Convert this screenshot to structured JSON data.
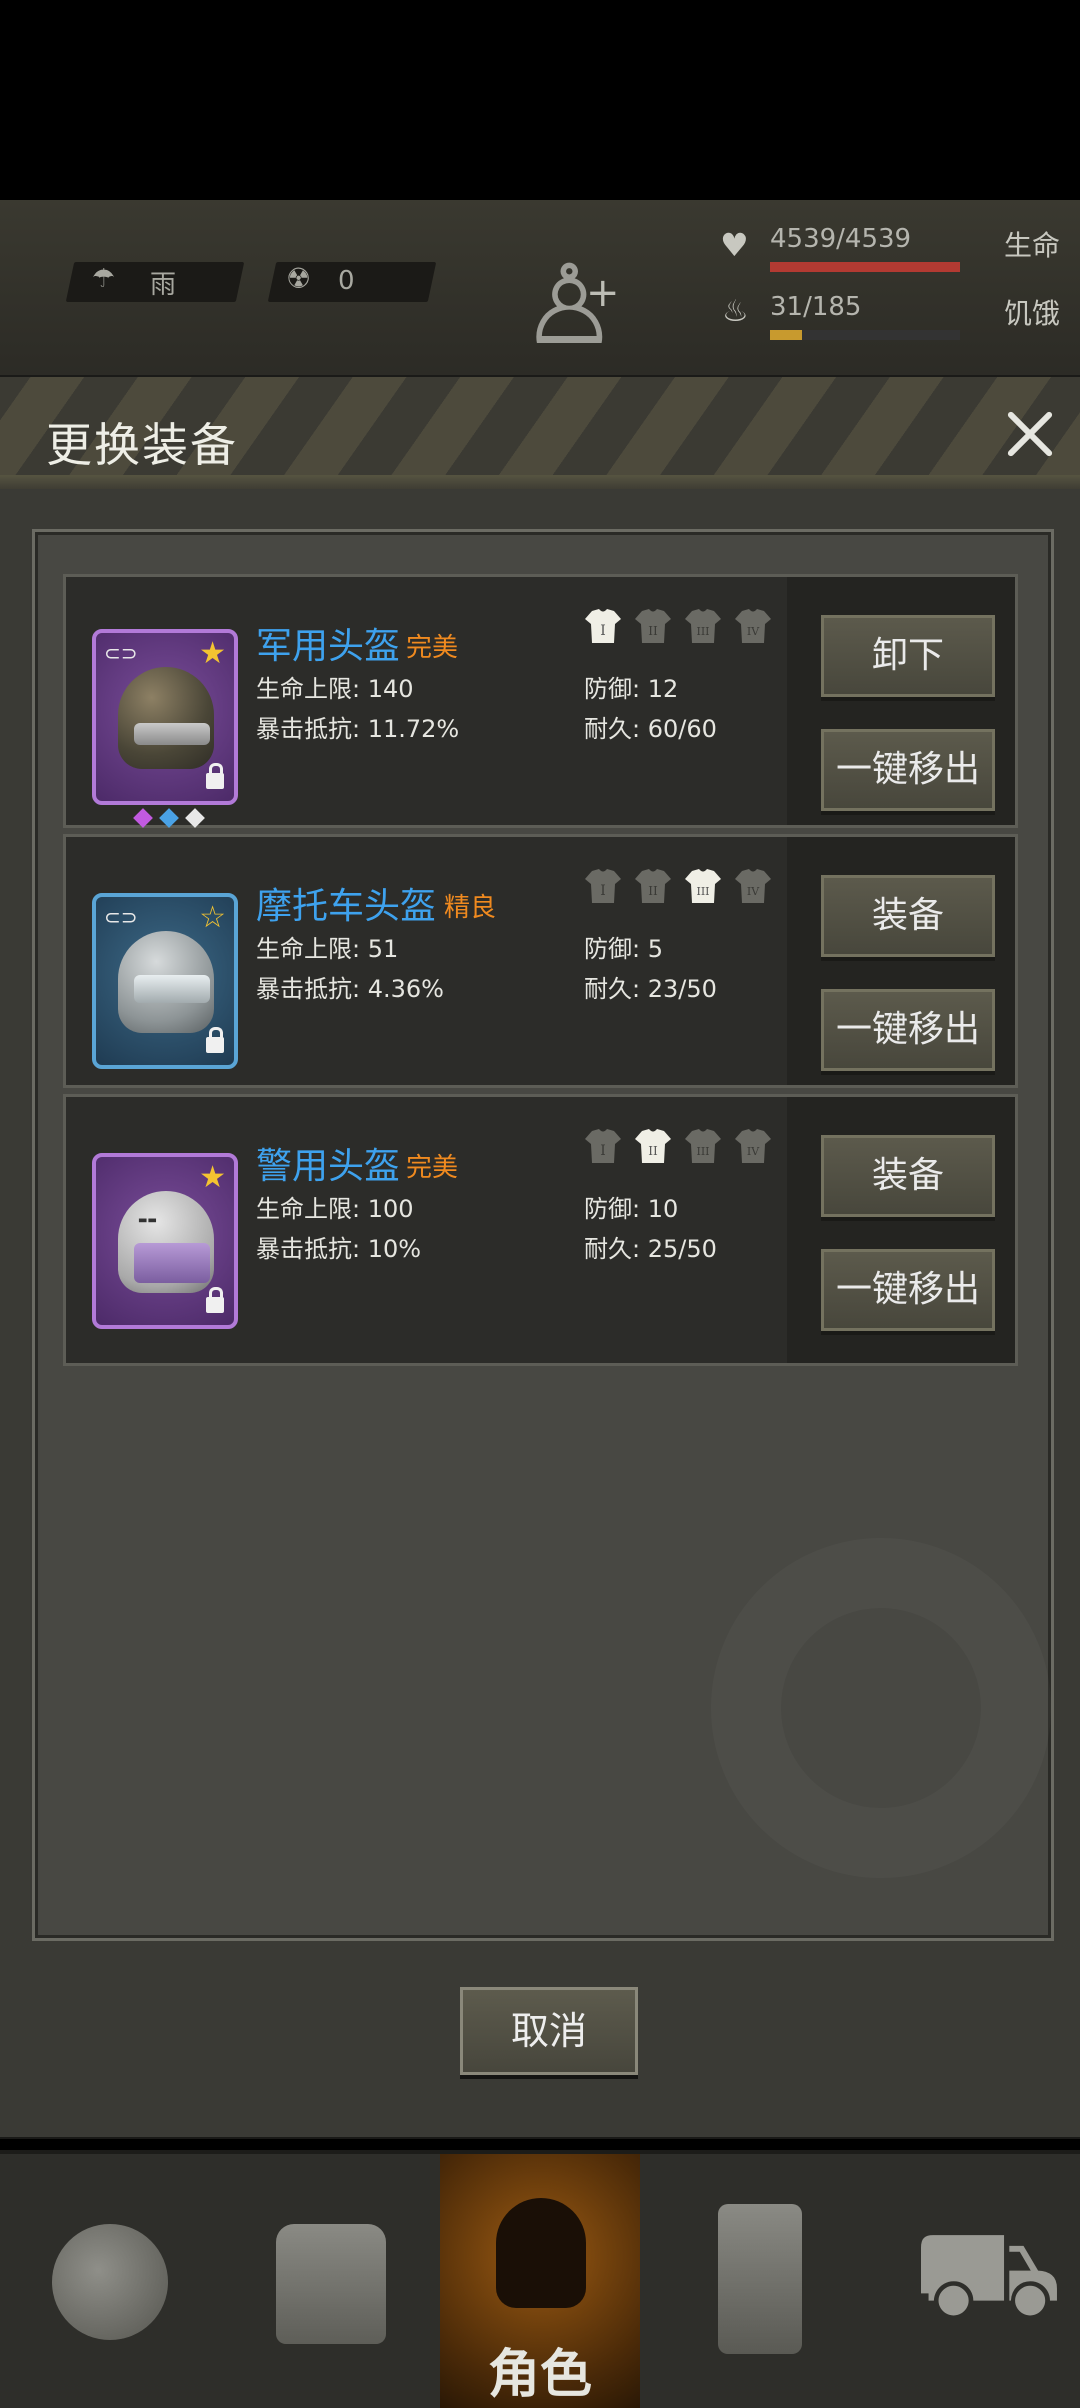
{
  "hud": {
    "weather": "雨",
    "radiation": "0",
    "health_value": "4539/4539",
    "health_label": "生命",
    "hunger_value": "31/185",
    "hunger_label": "饥饿"
  },
  "modal": {
    "title": "更换装备",
    "cancel_label": "取消"
  },
  "items": [
    {
      "name": "军用头盔",
      "quality": "完美",
      "hp": "生命上限: 140",
      "crit_resist": "暴击抵抗: 11.72%",
      "defense": "防御: 12",
      "durability": "耐久: 60/60",
      "btn1": "卸下",
      "btn2": "一键移出"
    },
    {
      "name": "摩托车头盔",
      "quality": "精良",
      "hp": "生命上限: 51",
      "crit_resist": "暴击抵抗: 4.36%",
      "defense": "防御: 5",
      "durability": "耐久: 23/50",
      "btn1": "装备",
      "btn2": "一键移出"
    },
    {
      "name": "警用头盔",
      "quality": "完美",
      "hp": "生命上限: 100",
      "crit_resist": "暴击抵抗: 10%",
      "defense": "防御: 10",
      "durability": "耐久: 25/50",
      "btn1": "装备",
      "btn2": "一键移出"
    }
  ],
  "nav": {
    "active_label": "角色"
  },
  "colors": {
    "name_blue": "#3ea2ee",
    "quality_orange": "#f08a1f",
    "health_bar": "#b33a32",
    "hunger_bar": "#c89a2e"
  }
}
